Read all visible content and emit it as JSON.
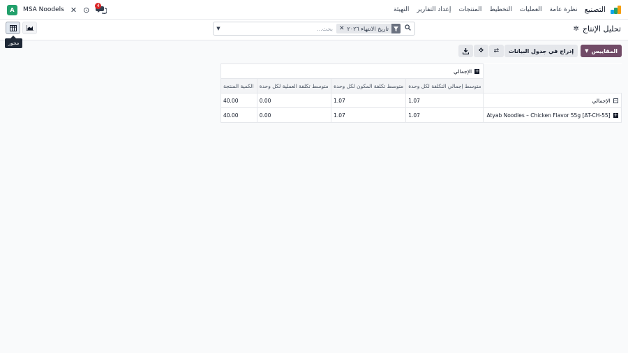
{
  "navbar": {
    "brand": "التصنيع",
    "menu": [
      "نظرة عامة",
      "العمليات",
      "التخطيط",
      "المنتجات",
      "إعداد التقارير",
      "التهيئة"
    ],
    "company": "MSA Noodels",
    "avatar_letter": "A",
    "chat_badge": "4",
    "accent": "#714b67"
  },
  "control": {
    "breadcrumb": "تحليل الإنتاج",
    "search": {
      "facet": "تاريخ الانتهاء ٢٠٢٦",
      "placeholder": "بحث..."
    },
    "tooltip": "محور",
    "views": [
      "pivot-icon",
      "graph-icon"
    ]
  },
  "buttons": {
    "measures": "المقاييس",
    "insert": "إدراج في جدول البيانات"
  },
  "pivot": {
    "col_total": "الإجمالي",
    "measures": [
      "متوسط إجمالي التكلفة لكل وحدة",
      "متوسط تكلفة المكون لكل وحدة",
      "متوسط تكلفة العملية لكل وحدة",
      "الكمية المنتجة"
    ],
    "rows": [
      {
        "label": "الإجمالي",
        "values": [
          "1.07",
          "1.07",
          "0.00",
          "40.00"
        ]
      },
      {
        "label": "Atyab Noodles – Chicken Flavor 55g [AT-CH-55]",
        "values": [
          "1.07",
          "1.07",
          "0.00",
          "40.00"
        ]
      }
    ]
  }
}
